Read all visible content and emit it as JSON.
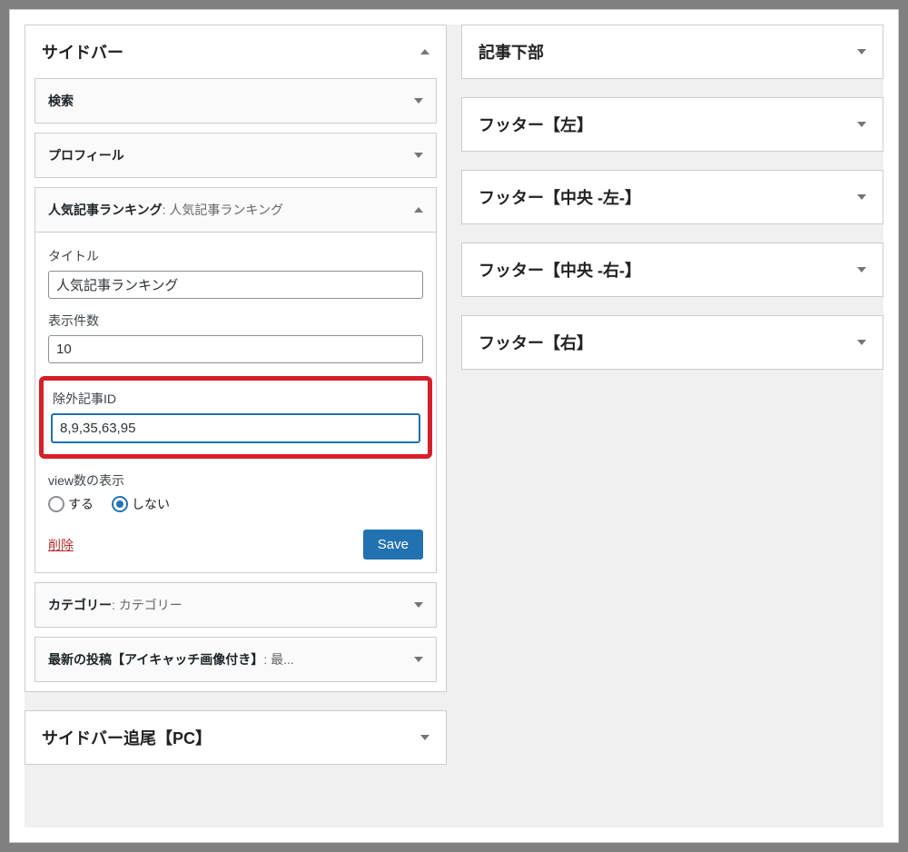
{
  "left": {
    "area1": {
      "title": "サイドバー",
      "widgets": [
        {
          "title": "検索",
          "subtitle": "",
          "expanded": false
        },
        {
          "title": "プロフィール",
          "subtitle": "",
          "expanded": false
        },
        {
          "title": "人気記事ランキング",
          "subtitle": ": 人気記事ランキング",
          "expanded": true,
          "form": {
            "title_label": "タイトル",
            "title_value": "人気記事ランキング",
            "count_label": "表示件数",
            "count_value": "10",
            "exclude_label": "除外記事ID",
            "exclude_value": "8,9,35,63,95",
            "view_label": "view数の表示",
            "view_yes": "する",
            "view_no": "しない",
            "view_selected": "no",
            "delete": "削除",
            "save": "Save"
          }
        },
        {
          "title": "カテゴリー",
          "subtitle": ": カテゴリー",
          "expanded": false
        },
        {
          "title": "最新の投稿【アイキャッチ画像付き】",
          "subtitle": ": 最...",
          "expanded": false
        }
      ]
    },
    "area2": {
      "title": "サイドバー追尾【PC】"
    }
  },
  "right": {
    "areas": [
      {
        "title": "記事下部"
      },
      {
        "title": "フッター【左】"
      },
      {
        "title": "フッター【中央 -左-】"
      },
      {
        "title": "フッター【中央 -右-】"
      },
      {
        "title": "フッター【右】"
      }
    ]
  }
}
